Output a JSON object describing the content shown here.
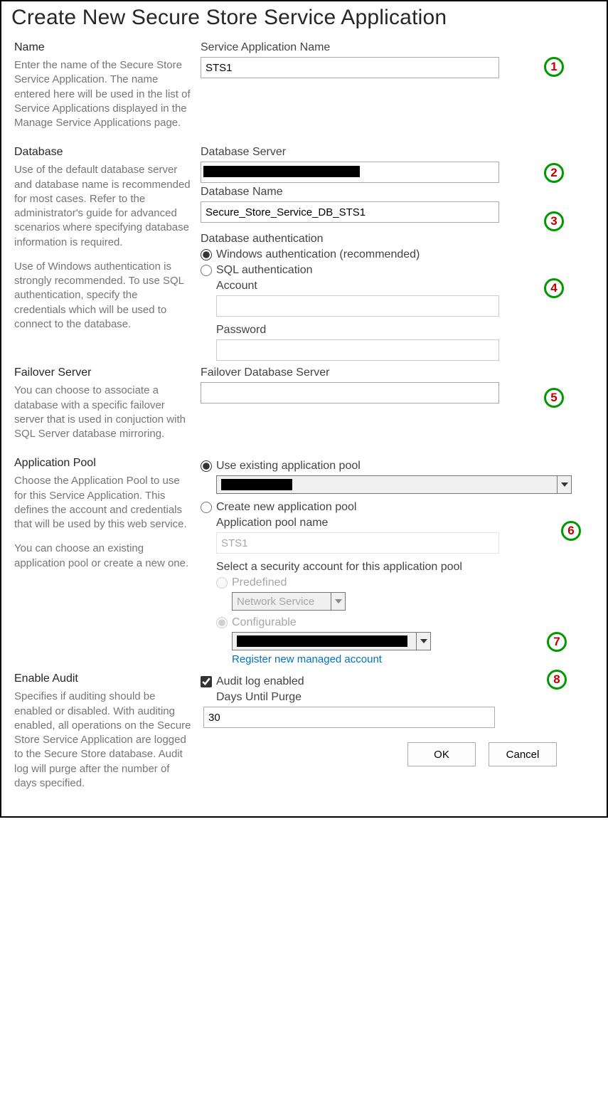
{
  "title": "Create New Secure Store Service Application",
  "sections": {
    "name": {
      "heading": "Name",
      "help": "Enter the name of the Secure Store Service Application. The name entered here will be used in the list of Service Applications displayed in the Manage Service Applications page.",
      "label": "Service Application Name",
      "value": "STS1"
    },
    "database": {
      "heading": "Database",
      "help1": "Use of the default database server and database name is recommended for most cases. Refer to the administrator's guide for advanced scenarios where specifying database information is required.",
      "help2": "Use of Windows authentication is strongly recommended. To use SQL authentication, specify the credentials which will be used to connect to the database.",
      "server_label": "Database Server",
      "server_value": "",
      "name_label": "Database Name",
      "name_value": "Secure_Store_Service_DB_STS1",
      "auth_label": "Database authentication",
      "auth_win": "Windows authentication (recommended)",
      "auth_sql": "SQL authentication",
      "account_label": "Account",
      "password_label": "Password"
    },
    "failover": {
      "heading": "Failover Server",
      "help": "You can choose to associate a database with a specific failover server that is used in conjuction with SQL Server database mirroring.",
      "label": "Failover Database Server",
      "value": ""
    },
    "apppool": {
      "heading": "Application Pool",
      "help1": "Choose the Application Pool to use for this Service Application.  This defines the account and credentials that will be used by this web service.",
      "help2": "You can choose an existing application pool or create a new one.",
      "use_existing": "Use existing application pool",
      "create_new": "Create new application pool",
      "pool_name_label": "Application pool name",
      "pool_name_value": "STS1",
      "security_label": "Select a security account for this application pool",
      "predefined": "Predefined",
      "predefined_value": "Network Service",
      "configurable": "Configurable",
      "register_link": "Register new managed account"
    },
    "audit": {
      "heading": "Enable Audit",
      "help": "Specifies if auditing should be enabled or disabled. With auditing enabled, all operations on the Secure Store Service Application are logged to the Secure Store database. Audit log will purge after the number of days specified.",
      "check_label": "Audit log enabled",
      "purge_label": "Days Until Purge",
      "purge_value": "30"
    }
  },
  "buttons": {
    "ok": "OK",
    "cancel": "Cancel"
  },
  "markers": [
    "1",
    "2",
    "3",
    "4",
    "5",
    "6",
    "7",
    "8"
  ]
}
